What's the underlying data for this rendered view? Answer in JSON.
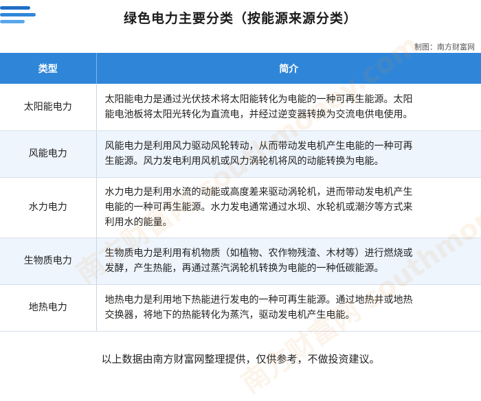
{
  "header": {
    "title": "绿色电力主要分类（按能源来源分类）",
    "credit": "制图：南方财富网"
  },
  "table": {
    "columns": [
      "类型",
      "简介"
    ],
    "rows": [
      {
        "type": "太阳能电力",
        "desc_lines": [
          "太阳能电力是通过光伏技术将太阳能转化为电能的一种可再生能源。太阳",
          "能电池板将太阳光转化为直流电，并经过逆变器转换为交流电供电使用。"
        ]
      },
      {
        "type": "风能电力",
        "desc_lines": [
          "风能电力是利用风力驱动风轮转动，从而带动发电机产生电能的一种可再",
          "生能源。风力发电利用风机或风力涡轮机将风的动能转换为电能。"
        ]
      },
      {
        "type": "水力电力",
        "desc_lines": [
          "水力电力是利用水流的动能或高度差来驱动涡轮机，进而带动发电机产生",
          "电能的一种可再生能源。水力发电通常通过水坝、水轮机或潮汐等方式来",
          "利用水的能量。"
        ]
      },
      {
        "type": "生物质电力",
        "desc_lines": [
          "生物质电力是利用有机物质（如植物、农作物残渣、木材等）进行燃烧或",
          "发酵，产生热能，再通过蒸汽涡轮机转换为电能的一种低碳能源。"
        ]
      },
      {
        "type": "地热电力",
        "desc_lines": [
          "地热电力是利用地下热能进行发电的一种可再生能源。通过地热井或地热",
          "交换器，将地下的热能转化为蒸汽，驱动发电机产生电能。"
        ]
      }
    ]
  },
  "footnote": "以上数据由南方财富网整理提供，仅供参考，不做投资建议。",
  "watermark_text": "南方财富网 southmoney.com",
  "colors": {
    "header_bg": "#2f86d9",
    "row_alt_bg": "#eef5fd",
    "logo_bar": "#2f86d9"
  }
}
